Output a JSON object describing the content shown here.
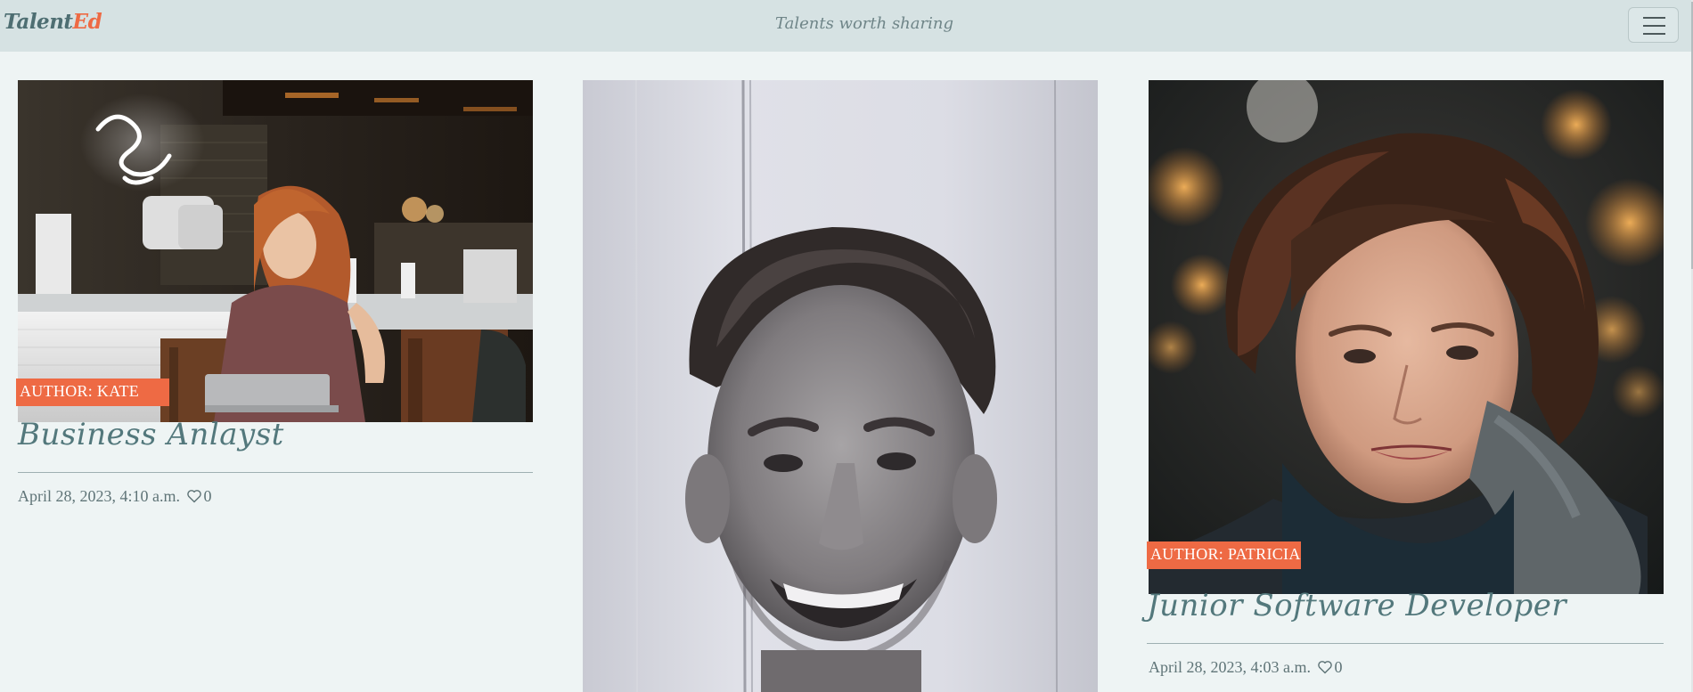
{
  "navbar": {
    "brand_prefix": "Talent",
    "brand_accent": "Ed",
    "tagline": "Talents worth sharing",
    "menu_icon": "hamburger-icon"
  },
  "colors": {
    "accent": "#ee6a44",
    "nav_bg": "#d6e2e3",
    "page_bg": "#eef4f4",
    "text": "#4e6e72"
  },
  "posts": [
    {
      "author_label": "AUTHOR: KATE",
      "title": "Business Anlayst",
      "date": "April 28, 2023, 4:10 a.m.",
      "likes": "0",
      "like_icon": "heart-icon"
    },
    {
      "author_label": "",
      "title": "",
      "date": "",
      "likes": ""
    },
    {
      "author_label": "AUTHOR: PATRICIA",
      "title": "Junior Software Developer",
      "date": "April 28, 2023, 4:03 a.m.",
      "likes": "0",
      "like_icon": "heart-icon"
    }
  ]
}
